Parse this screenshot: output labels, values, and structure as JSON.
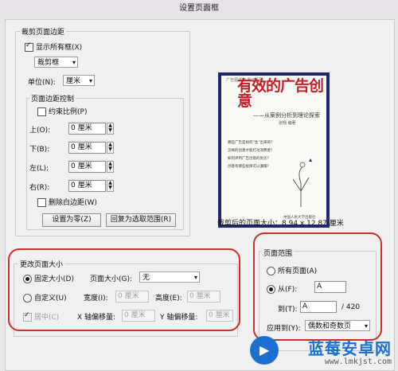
{
  "window": {
    "title": "设置页面框"
  },
  "crop_margins": {
    "group_label": "裁剪页面边距",
    "show_all_boxes": {
      "label": "显示所有框(X)",
      "checked": true
    },
    "box_select": "裁剪框",
    "unit_label": "单位(N):",
    "unit_select": "厘米",
    "control": {
      "group_label": "页面边距控制",
      "constrain": {
        "label": "约束比例(P)",
        "checked": false
      },
      "top": {
        "label": "上(O):",
        "value": "0 厘米"
      },
      "bottom": {
        "label": "下(B):",
        "value": "0 厘米"
      },
      "left": {
        "label": "左(L):",
        "value": "0 厘米"
      },
      "right": {
        "label": "右(R):",
        "value": "0 厘米"
      },
      "remove_white": {
        "label": "删除白边距(W)",
        "checked": false
      },
      "set_zero_button": "设置为零(Z)",
      "revert_button": "回复为选取范围(R)"
    }
  },
  "preview": {
    "caption": "裁剪后的页面大小：8.94 x 12.87 厘米",
    "cover": {
      "top_text": "广告图书馆·新创系列",
      "title": "有效的广告创意",
      "subtitle": "——从案例分析到理论探索",
      "author": "张翔 编著",
      "lines": [
        "哪些广告是如何“生”出来的？",
        "怎样的创意才能打动消费者？",
        "如何评判广告创意的优劣？",
        "创意有哪些规律可以遵循？"
      ],
      "publisher": "中国人民大学出版社"
    }
  },
  "change_page_size": {
    "group_label": "更改页面大小",
    "fixed": {
      "label": "固定大小(D)",
      "selected": true
    },
    "page_size_label": "页面大小(G):",
    "page_size_value": "无",
    "custom": {
      "label": "自定义(U)",
      "selected": false
    },
    "width_label": "宽度(I):",
    "width_value": "0 厘米",
    "height_label": "高度(E):",
    "height_value": "0 厘米",
    "center": {
      "label": "居中(C)",
      "checked": true
    },
    "x_offset_label": "X 轴偏移量:",
    "x_offset_value": "0 厘米",
    "y_offset_label": "Y 轴偏移量:",
    "y_offset_value": "0 厘米"
  },
  "page_range": {
    "group_label": "页面范围",
    "all_pages": {
      "label": "所有页面(A)",
      "selected": false
    },
    "from": {
      "label": "从(F):",
      "value": "A",
      "selected": true
    },
    "to_label": "到(T):",
    "to_value": "A",
    "total": "/ 420",
    "apply_label": "应用到(Y):",
    "apply_value": "偶数和奇数页"
  },
  "watermark": {
    "name": "蓝莓安卓网",
    "url": "www.lmkjst.com"
  },
  "colors": {
    "annotation_red": "#c9302c",
    "cover_blue": "#1d2a6e",
    "cover_red": "#c1202a",
    "watermark_blue": "#1d6fd1"
  }
}
